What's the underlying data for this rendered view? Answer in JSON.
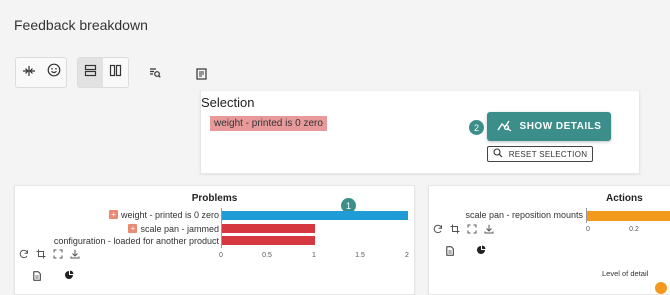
{
  "page": {
    "title": "Feedback breakdown"
  },
  "selection": {
    "title": "Selection",
    "chip": "weight - printed is 0 zero",
    "badge": "2",
    "show_details_label": "SHOW DETAILS",
    "reset_label": "RESET SELECTION"
  },
  "problems": {
    "title": "Problems",
    "badge": "1",
    "rows": [
      {
        "label": "weight - printed is 0 zero",
        "value": 2,
        "color": "#1f9bd6",
        "has_plus": true
      },
      {
        "label": "scale pan - jammed",
        "value": 1,
        "color": "#d5383f",
        "has_plus": true
      },
      {
        "label": "configuration - loaded for another product",
        "value": 1,
        "color": "#d5383f",
        "has_plus": false
      }
    ],
    "ticks": [
      "0",
      "0.5",
      "1",
      "1.5",
      "2"
    ]
  },
  "actions": {
    "title": "Actions",
    "rows": [
      {
        "label": "scale pan - reposition mounts",
        "color": "#f39a1e"
      }
    ],
    "ticks": [
      "0",
      "0.2"
    ],
    "level_of_detail_label": "Level of detail"
  },
  "colors": {
    "accent": "#3b8e8a",
    "problem_bar": "#d5383f",
    "selected_bar": "#1f9bd6",
    "action_bar": "#f39a1e"
  }
}
